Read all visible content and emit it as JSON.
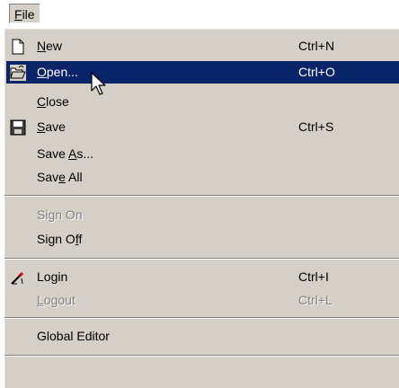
{
  "menubar": {
    "file_prefix": "",
    "file_mnemonic": "F",
    "file_rest": "ile"
  },
  "menu": {
    "new": {
      "pre": "",
      "mn": "N",
      "post": "ew",
      "shortcut": "Ctrl+N",
      "icon": "new-document-icon"
    },
    "open": {
      "pre": "",
      "mn": "O",
      "post": "pen...",
      "shortcut": "Ctrl+O",
      "icon": "open-folder-icon"
    },
    "close": {
      "pre": "",
      "mn": "C",
      "post": "lose"
    },
    "save": {
      "pre": "",
      "mn": "S",
      "post": "ave",
      "shortcut": "Ctrl+S",
      "icon": "floppy-disk-icon"
    },
    "save_as": {
      "pre": "Save ",
      "mn": "A",
      "post": "s..."
    },
    "save_all": {
      "pre": "Sav",
      "mn": "e",
      "post": " All"
    },
    "sign_on": {
      "pre": "Si",
      "mn": "g",
      "post": "n On",
      "disabled": true
    },
    "sign_off": {
      "pre": "Sign O",
      "mn": "f",
      "post": "f"
    },
    "login": {
      "pre": "Lo",
      "mn": "g",
      "post": "in",
      "shortcut": "Ctrl+I",
      "icon": "login-pen-icon"
    },
    "logout": {
      "pre": "",
      "mn": "L",
      "post": "ogout",
      "shortcut": "Ctrl+L",
      "disabled": true
    },
    "global_editor": {
      "label": "Global Editor"
    }
  },
  "colors": {
    "menu_bg": "#d4d0c8",
    "highlight": "#0a246a",
    "disabled": "#808080"
  }
}
